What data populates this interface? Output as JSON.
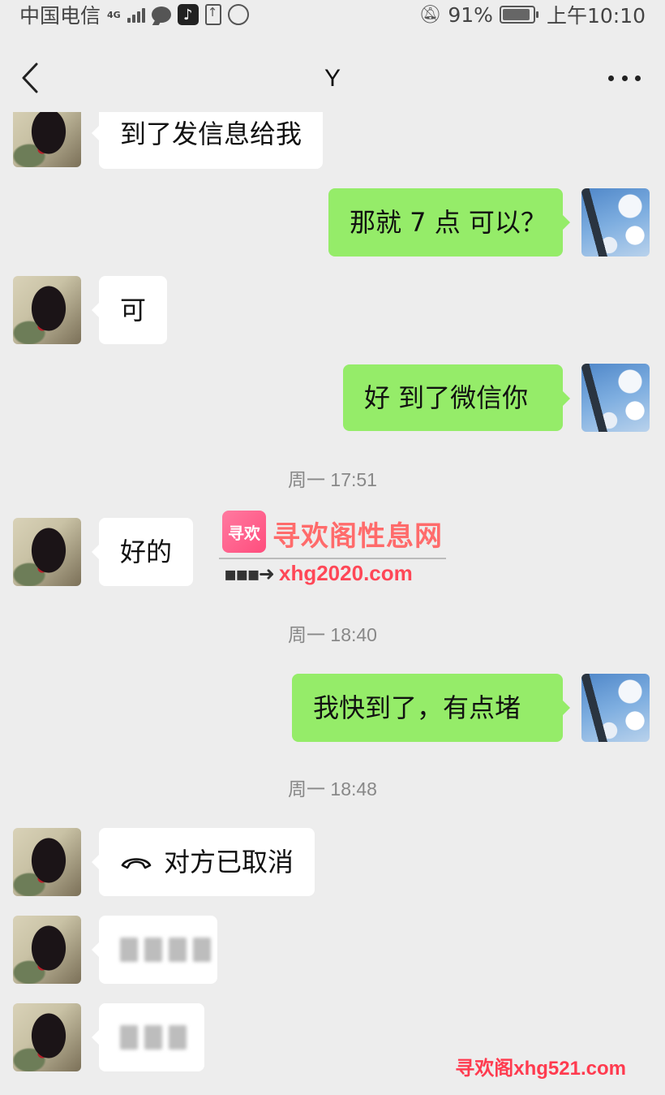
{
  "status_bar": {
    "carrier": "中国电信",
    "network": "4G",
    "battery": "91%",
    "time": "上午10:10",
    "icons": [
      "signal-icon",
      "message-icon",
      "tiktok-icon",
      "upload-icon",
      "cast-icon",
      "bell-off-icon",
      "battery-icon"
    ]
  },
  "header": {
    "title": "Y",
    "back_icon": "chevron-left-icon",
    "more_icon": "more-icon"
  },
  "messages": [
    {
      "side": "left",
      "text": "到了发信息给我"
    },
    {
      "side": "right",
      "text": "那就 7 点 可以？"
    },
    {
      "side": "left",
      "text": "可"
    },
    {
      "side": "right",
      "text": "好 到了微信你"
    },
    {
      "type": "timestamp",
      "text": "周一 17:51"
    },
    {
      "side": "left",
      "text": "好的"
    },
    {
      "type": "timestamp",
      "text": "周一 18:40"
    },
    {
      "side": "right",
      "text": "我快到了，有点堵"
    },
    {
      "type": "timestamp",
      "text": "周一 18:48"
    },
    {
      "side": "left",
      "kind": "call",
      "text": "对方已取消"
    },
    {
      "side": "left",
      "kind": "blurred"
    },
    {
      "side": "left",
      "kind": "blurred"
    }
  ],
  "watermarks": {
    "mid_logo": "寻欢",
    "mid_title": "寻欢阁性息网",
    "mid_url": "xhg2020.com",
    "bottom": "寻欢阁xhg521.com"
  },
  "colors": {
    "background": "#ededed",
    "bubble_self": "#95ec69",
    "bubble_other": "#ffffff",
    "timestamp": "#888888"
  }
}
